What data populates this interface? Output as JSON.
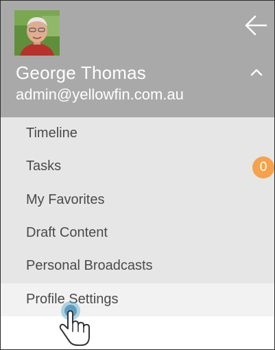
{
  "user": {
    "name": "George Thomas",
    "email": "admin@yellowfin.com.au"
  },
  "icons": {
    "back": "arrow-left-icon",
    "collapse": "chevron-up-icon",
    "pointer": "hand-pointer-icon"
  },
  "menu": {
    "items": [
      {
        "label": "Timeline"
      },
      {
        "label": "Tasks",
        "badge": "0"
      },
      {
        "label": "My Favorites"
      },
      {
        "label": "Draft Content"
      },
      {
        "label": "Personal Broadcasts"
      },
      {
        "label": "Profile Settings"
      }
    ]
  },
  "colors": {
    "header_bg": "#a9a9a9",
    "menu_bg": "#e6e6e6",
    "active_bg": "#f2f2f2",
    "badge": "#f7a24a",
    "text": "#4a4a4a"
  }
}
